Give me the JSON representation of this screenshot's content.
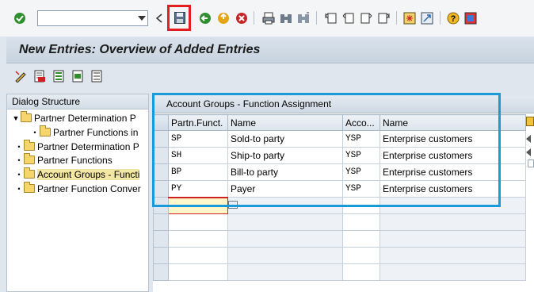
{
  "toolbar": {
    "command_field_value": "",
    "icons": [
      "enter-icon",
      "save-icon",
      "back-icon",
      "exit-icon",
      "cancel-icon",
      "print-icon",
      "find-icon",
      "find-next-icon",
      "first-page-icon",
      "previous-page-icon",
      "next-page-icon",
      "last-page-icon",
      "create-session-icon",
      "shortcut-icon",
      "help-icon",
      "customize-layout-icon"
    ],
    "highlight_color": "#e41e1e"
  },
  "title": "New Entries: Overview of Added Entries",
  "app_toolbar": {
    "icons": [
      "display-change-icon",
      "delete-icon",
      "select-all-icon",
      "select-block-icon",
      "deselect-all-icon"
    ]
  },
  "dialog_structure": {
    "header": "Dialog Structure",
    "items": [
      {
        "label": "Partner Determination P",
        "level": 0,
        "expanded": true
      },
      {
        "label": "Partner Functions in",
        "level": 1
      },
      {
        "label": "Partner Determination P",
        "level": 0
      },
      {
        "label": "Partner Functions",
        "level": 0
      },
      {
        "label": "Account Groups - Functi",
        "level": 0,
        "selected": true
      },
      {
        "label": "Partner Function Conver",
        "level": 0
      }
    ]
  },
  "table": {
    "title": "Account Groups - Function Assignment",
    "columns": [
      "Partn.Funct.",
      "Name",
      "Acco...",
      "Name"
    ],
    "rows": [
      {
        "partner_function": "SP",
        "name": "Sold-to party",
        "account_group": "YSP",
        "group_name": "Enterprise customers"
      },
      {
        "partner_function": "SH",
        "name": "Ship-to party",
        "account_group": "YSP",
        "group_name": "Enterprise customers"
      },
      {
        "partner_function": "BP",
        "name": "Bill-to party",
        "account_group": "YSP",
        "group_name": "Enterprise customers"
      },
      {
        "partner_function": "PY",
        "name": "Payer",
        "account_group": "YSP",
        "group_name": "Enterprise customers"
      }
    ],
    "highlight_color": "#1a9ad9"
  }
}
